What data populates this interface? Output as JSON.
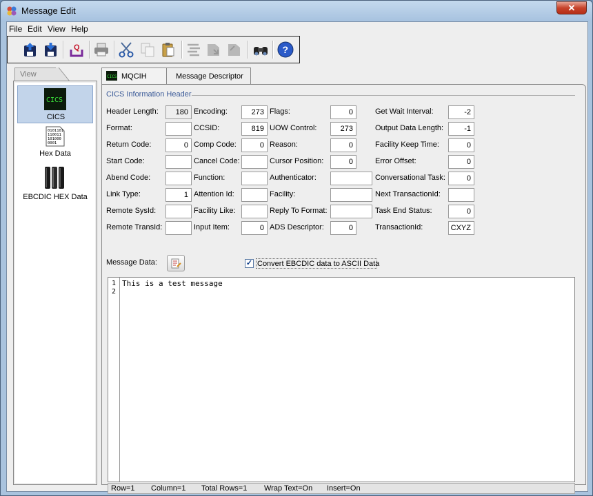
{
  "window": {
    "title": "Message Edit",
    "close_label": "✕"
  },
  "menu": [
    "File",
    "Edit",
    "View",
    "Help"
  ],
  "toolbar": {
    "buttons": [
      {
        "name": "save-icon"
      },
      {
        "name": "save-as-icon"
      },
      {
        "name": "q-icon"
      },
      {
        "name": "print-icon"
      },
      {
        "name": "cut-icon"
      },
      {
        "name": "copy-icon"
      },
      {
        "name": "paste-icon"
      },
      {
        "name": "format-icon"
      },
      {
        "name": "import-icon"
      },
      {
        "name": "export-icon"
      },
      {
        "name": "find-icon"
      },
      {
        "name": "help-icon"
      }
    ]
  },
  "sidebar": {
    "view_tab": "View",
    "items": [
      {
        "label": "CICS",
        "selected": true,
        "icon": "cics-icon",
        "icon_text": "CICS"
      },
      {
        "label": "Hex Data",
        "selected": false,
        "icon": "hex-data-icon",
        "icon_text": "0101101\n110011\n101000\n0001"
      },
      {
        "label": "EBCDIC HEX Data",
        "selected": false,
        "icon": "ebcdic-hex-icon"
      }
    ]
  },
  "tabs": [
    {
      "label": "MQCIH",
      "active": true,
      "icon_text": "CICS"
    },
    {
      "label": "Message Descriptor",
      "active": false
    }
  ],
  "section_title": "CICS Information Header",
  "fields": {
    "col1": [
      {
        "label": "Header Length:",
        "value": "180",
        "readonly": true
      },
      {
        "label": "Format:",
        "value": ""
      },
      {
        "label": "Return Code:",
        "value": "0"
      },
      {
        "label": "Start Code:",
        "value": ""
      },
      {
        "label": "Abend Code:",
        "value": ""
      },
      {
        "label": "Link Type:",
        "value": "1"
      },
      {
        "label": "Remote SysId:",
        "value": ""
      },
      {
        "label": "Remote TransId:",
        "value": ""
      }
    ],
    "col2": [
      {
        "label": "Encoding:",
        "value": "273"
      },
      {
        "label": "CCSID:",
        "value": "819"
      },
      {
        "label": "Comp Code:",
        "value": "0"
      },
      {
        "label": "Cancel Code:",
        "value": ""
      },
      {
        "label": "Function:",
        "value": ""
      },
      {
        "label": "Attention Id:",
        "value": ""
      },
      {
        "label": "Facility Like:",
        "value": ""
      },
      {
        "label": "Input Item:",
        "value": "0"
      }
    ],
    "col3": [
      {
        "label": "Flags:",
        "value": "0"
      },
      {
        "label": "UOW Control:",
        "value": "273"
      },
      {
        "label": "Reason:",
        "value": "0"
      },
      {
        "label": "Cursor Position:",
        "value": "0"
      },
      {
        "label": "Authenticator:",
        "value": ""
      },
      {
        "label": "Facility:",
        "value": ""
      },
      {
        "label": "Reply To Format:",
        "value": ""
      },
      {
        "label": "ADS Descriptor:",
        "value": "0"
      }
    ],
    "col4": [
      {
        "label": "Get Wait Interval:",
        "value": "-2"
      },
      {
        "label": "Output Data Length:",
        "value": "-1"
      },
      {
        "label": "Facility Keep Time:",
        "value": "0"
      },
      {
        "label": "Error Offset:",
        "value": "0"
      },
      {
        "label": "Conversational Task:",
        "value": "0"
      },
      {
        "label": "Next TransactionId:",
        "value": ""
      },
      {
        "label": "Task End Status:",
        "value": "0"
      },
      {
        "label": "TransactionId:",
        "value": "CXYZ"
      }
    ]
  },
  "message_data_label": "Message Data:",
  "convert": {
    "label": "Convert EBCDIC data to ASCII Data",
    "checked": true,
    "check_glyph": "✓"
  },
  "editor": {
    "line_numbers": [
      "1",
      "2"
    ],
    "text": "This is a test message"
  },
  "status": {
    "row": "Row=1",
    "column": "Column=1",
    "total_rows": "Total Rows=1",
    "wrap": "Wrap Text=On",
    "insert": "Insert=On"
  }
}
